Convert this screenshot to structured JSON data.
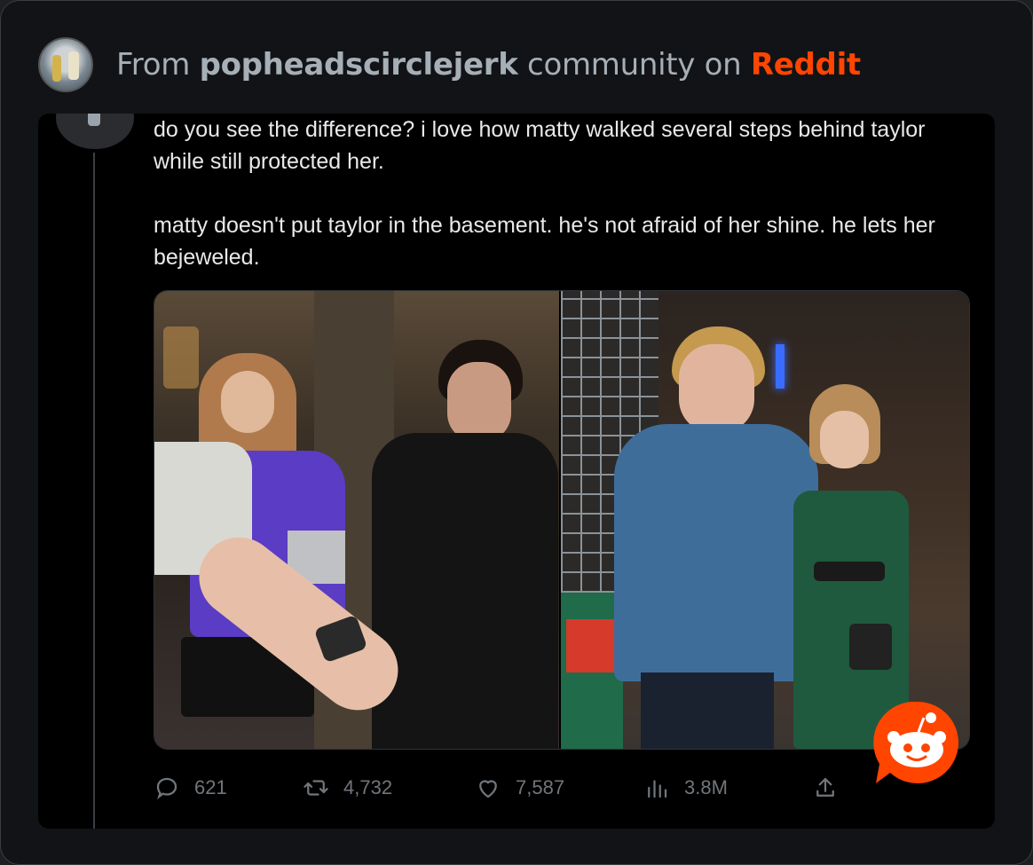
{
  "header": {
    "from_prefix": "From",
    "community": "popheadscirclejerk",
    "middle": "community on",
    "platform": "Reddit"
  },
  "tweet": {
    "paragraph_1": "do you see the difference? i love how matty walked several steps behind taylor while still protected her.",
    "paragraph_2": "matty doesn't put taylor in the basement. he's not afraid of her shine. he lets her bejeweled."
  },
  "actions": {
    "replies": "621",
    "retweets": "4,732",
    "likes": "7,587",
    "views": "3.8M"
  },
  "colors": {
    "accent": "#ff4500",
    "muted": "#71767b",
    "text": "#e7e9ea",
    "background": "#000000"
  },
  "icons": [
    "reply-icon",
    "retweet-icon",
    "like-icon",
    "views-icon",
    "share-icon",
    "reddit-snoo-icon"
  ]
}
